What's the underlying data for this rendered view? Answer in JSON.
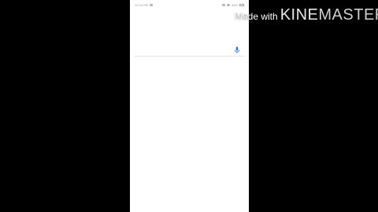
{
  "status_bar": {
    "left_text": "12:34 PM",
    "right_text": "58%",
    "background": "#ffffff"
  },
  "search": {
    "value": "",
    "placeholder": "",
    "mic_icon": "mic-icon",
    "mic_color": "#1a73e8"
  },
  "watermark": {
    "made_with": "Made with",
    "brand_kine": "KINE",
    "brand_master": "MASTER"
  },
  "colors": {
    "background": "#000000",
    "screen": "#ffffff",
    "divider": "#e4e4e4"
  }
}
